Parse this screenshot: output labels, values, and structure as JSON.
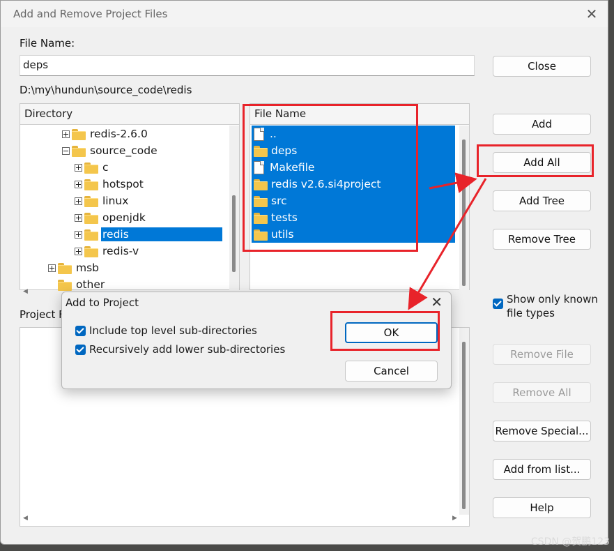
{
  "window": {
    "title": "Add and Remove Project Files",
    "close_icon": "close-icon"
  },
  "file_name": {
    "label": "File Name:",
    "value": "deps"
  },
  "current_path": "D:\\my\\hundun\\source_code\\redis",
  "directory_panel": {
    "header": "Directory",
    "items": [
      {
        "label": "redis-2.6.0",
        "expander": "plus"
      },
      {
        "label": "source_code",
        "expander": "minus"
      },
      {
        "label": "c",
        "expander": "plus"
      },
      {
        "label": "hotspot",
        "expander": "plus"
      },
      {
        "label": "linux",
        "expander": "plus"
      },
      {
        "label": "openjdk",
        "expander": "plus"
      },
      {
        "label": "redis",
        "expander": "plus",
        "selected": true
      },
      {
        "label": "redis-v",
        "expander": "plus"
      },
      {
        "label": "msb",
        "expander": "plus"
      },
      {
        "label": "other",
        "expander": "none"
      }
    ]
  },
  "file_panel": {
    "header": "File Name",
    "items": [
      {
        "label": "..",
        "icon": "file-icon"
      },
      {
        "label": "deps",
        "icon": "folder-icon"
      },
      {
        "label": "Makefile",
        "icon": "file-icon"
      },
      {
        "label": "redis v2.6.si4project",
        "icon": "folder-icon"
      },
      {
        "label": "src",
        "icon": "folder-icon"
      },
      {
        "label": "tests",
        "icon": "folder-icon"
      },
      {
        "label": "utils",
        "icon": "folder-icon"
      }
    ]
  },
  "project_panel": {
    "label": "Project F"
  },
  "buttons": {
    "close": "Close",
    "add": "Add",
    "add_all": "Add All",
    "add_tree": "Add Tree",
    "remove_tree": "Remove Tree",
    "remove_file": "Remove File",
    "remove_all": "Remove All",
    "remove_special": "Remove Special...",
    "add_from_list": "Add from list...",
    "help": "Help"
  },
  "show_only_known": {
    "label_line1": "Show only known",
    "label_line2": "file types",
    "checked": true
  },
  "dialog": {
    "title": "Add to Project",
    "option1": {
      "label": "Include top level sub-directories",
      "checked": true
    },
    "option2": {
      "label": "Recursively add lower sub-directories",
      "checked": true
    },
    "ok": "OK",
    "cancel": "Cancel"
  },
  "annotation_color": "#e8232a",
  "accent_color": "#0078d7",
  "watermark": "CSDN @贺鹏123"
}
